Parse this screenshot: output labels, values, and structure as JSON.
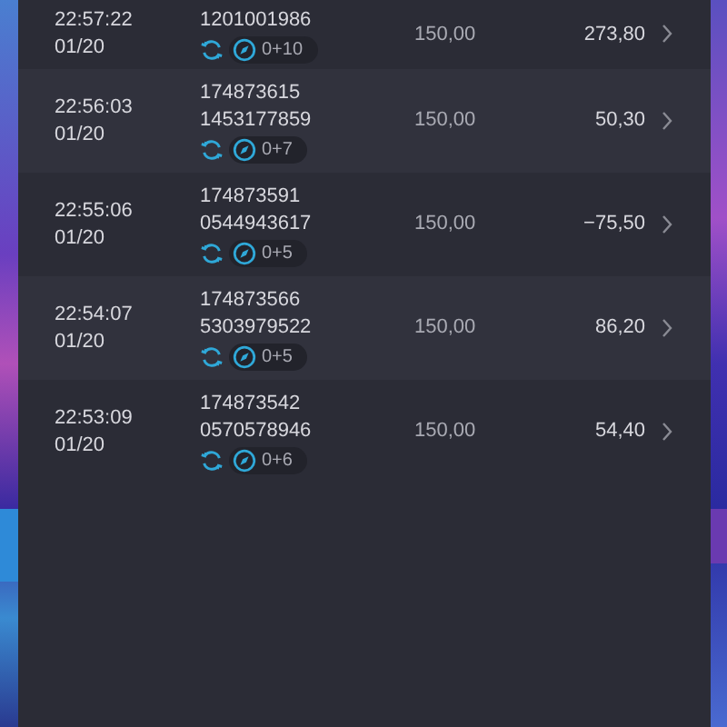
{
  "rows": [
    {
      "time": "22:57:22",
      "date": "01/20",
      "ids": [
        "1201001986"
      ],
      "count": "0+10",
      "price": "150,00",
      "amount": "273,80"
    },
    {
      "time": "22:56:03",
      "date": "01/20",
      "ids": [
        "174873615",
        "1453177859"
      ],
      "count": "0+7",
      "price": "150,00",
      "amount": "50,30"
    },
    {
      "time": "22:55:06",
      "date": "01/20",
      "ids": [
        "174873591",
        "0544943617"
      ],
      "count": "0+5",
      "price": "150,00",
      "amount": "−75,50"
    },
    {
      "time": "22:54:07",
      "date": "01/20",
      "ids": [
        "174873566",
        "5303979522"
      ],
      "count": "0+5",
      "price": "150,00",
      "amount": "86,20"
    },
    {
      "time": "22:53:09",
      "date": "01/20",
      "ids": [
        "174873542",
        "0570578946"
      ],
      "count": "0+6",
      "price": "150,00",
      "amount": "54,40"
    }
  ]
}
